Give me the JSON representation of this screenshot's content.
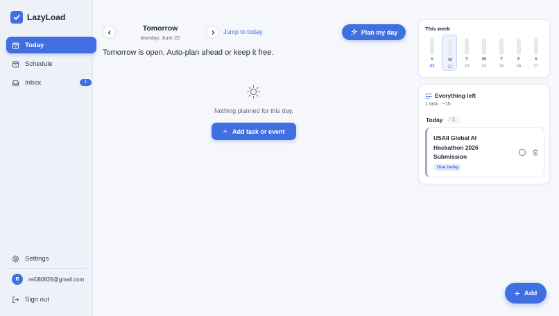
{
  "app": {
    "name": "LazyLoad"
  },
  "sidebar": {
    "items": [
      {
        "label": "Today",
        "icon": "calendar-check-icon",
        "active": true
      },
      {
        "label": "Schedule",
        "icon": "calendar-icon"
      },
      {
        "label": "Inbox",
        "icon": "inbox-icon",
        "badge": "1"
      }
    ],
    "settings_label": "Settings",
    "user": {
      "initial": "R",
      "email": "rei080826@gmail.com"
    },
    "signout_label": "Sign out"
  },
  "header": {
    "title": "Tomorrow",
    "date": "Monday, June 22",
    "jump_label": "Jump to today",
    "plan_label": "Plan my day"
  },
  "main": {
    "headline": "Tomorrow is open. Auto-plan ahead or keep it free.",
    "empty_text": "Nothing planned for this day.",
    "add_task_label": "Add task or event"
  },
  "week": {
    "title": "This week",
    "days": [
      {
        "letter": "S",
        "num": "21"
      },
      {
        "letter": "M",
        "num": "22"
      },
      {
        "letter": "T",
        "num": "23"
      },
      {
        "letter": "W",
        "num": "24"
      },
      {
        "letter": "T",
        "num": "25"
      },
      {
        "letter": "F",
        "num": "26"
      },
      {
        "letter": "S",
        "num": "27"
      }
    ]
  },
  "left_panel": {
    "title": "Everything left",
    "subtitle": "1 task · ~1h",
    "group_label": "Today",
    "group_count": "1",
    "task": {
      "title": "USAII Global AI Hackathon 2026 Submission",
      "due_label": "Due today"
    }
  },
  "fab": {
    "label": "Add"
  },
  "colors": {
    "accent": "#3f6fe0",
    "background": "#f5f7fb",
    "sidebar": "#eef1f8"
  }
}
